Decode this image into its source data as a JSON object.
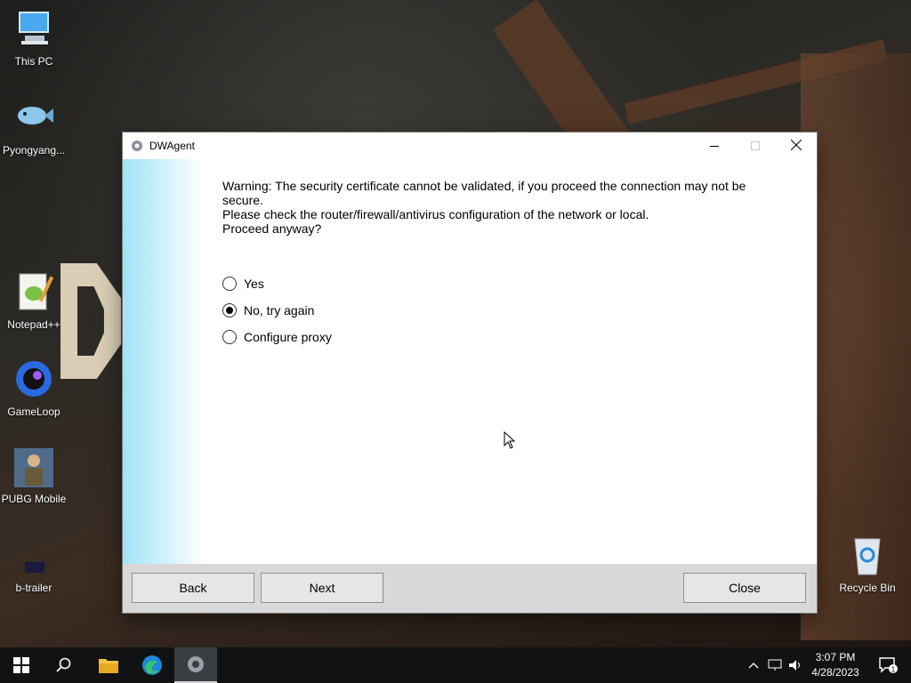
{
  "desktop": {
    "icons": [
      {
        "label": "This PC",
        "icon": "computer-icon"
      },
      {
        "label": "Pyongyang...",
        "icon": "fish-icon"
      },
      {
        "label": "Notepad++",
        "icon": "notepadpp-icon"
      },
      {
        "label": "GameLoop",
        "icon": "gameloop-icon"
      },
      {
        "label": "PUBG Mobile",
        "icon": "pubg-icon"
      },
      {
        "label": "b-trailer",
        "icon": "video-file-icon"
      },
      {
        "label": "Recycle Bin",
        "icon": "recycle-bin-icon"
      }
    ]
  },
  "window": {
    "title": "DWAgent",
    "message": [
      "Warning: The security certificate cannot be validated, if you proceed the connection may not be secure.",
      "Please check the router/firewall/antivirus configuration of the network or local.",
      "Proceed anyway?"
    ],
    "options": [
      {
        "label": "Yes",
        "checked": false
      },
      {
        "label": "No, try again",
        "checked": true
      },
      {
        "label": "Configure proxy",
        "checked": false
      }
    ],
    "buttons": {
      "back": "Back",
      "next": "Next",
      "close": "Close"
    }
  },
  "taskbar": {
    "items": [
      "windows-start-icon",
      "search-icon",
      "file-explorer-icon",
      "edge-icon",
      "dwagent-icon"
    ],
    "active": "dwagent-icon",
    "clock": {
      "time": "3:07 PM",
      "date": "4/28/2023"
    },
    "notification_count": "1"
  },
  "colors": {
    "accent_gradient": "#9fe3f6",
    "footer": "#d8d8d8",
    "taskbar": "#101214"
  }
}
